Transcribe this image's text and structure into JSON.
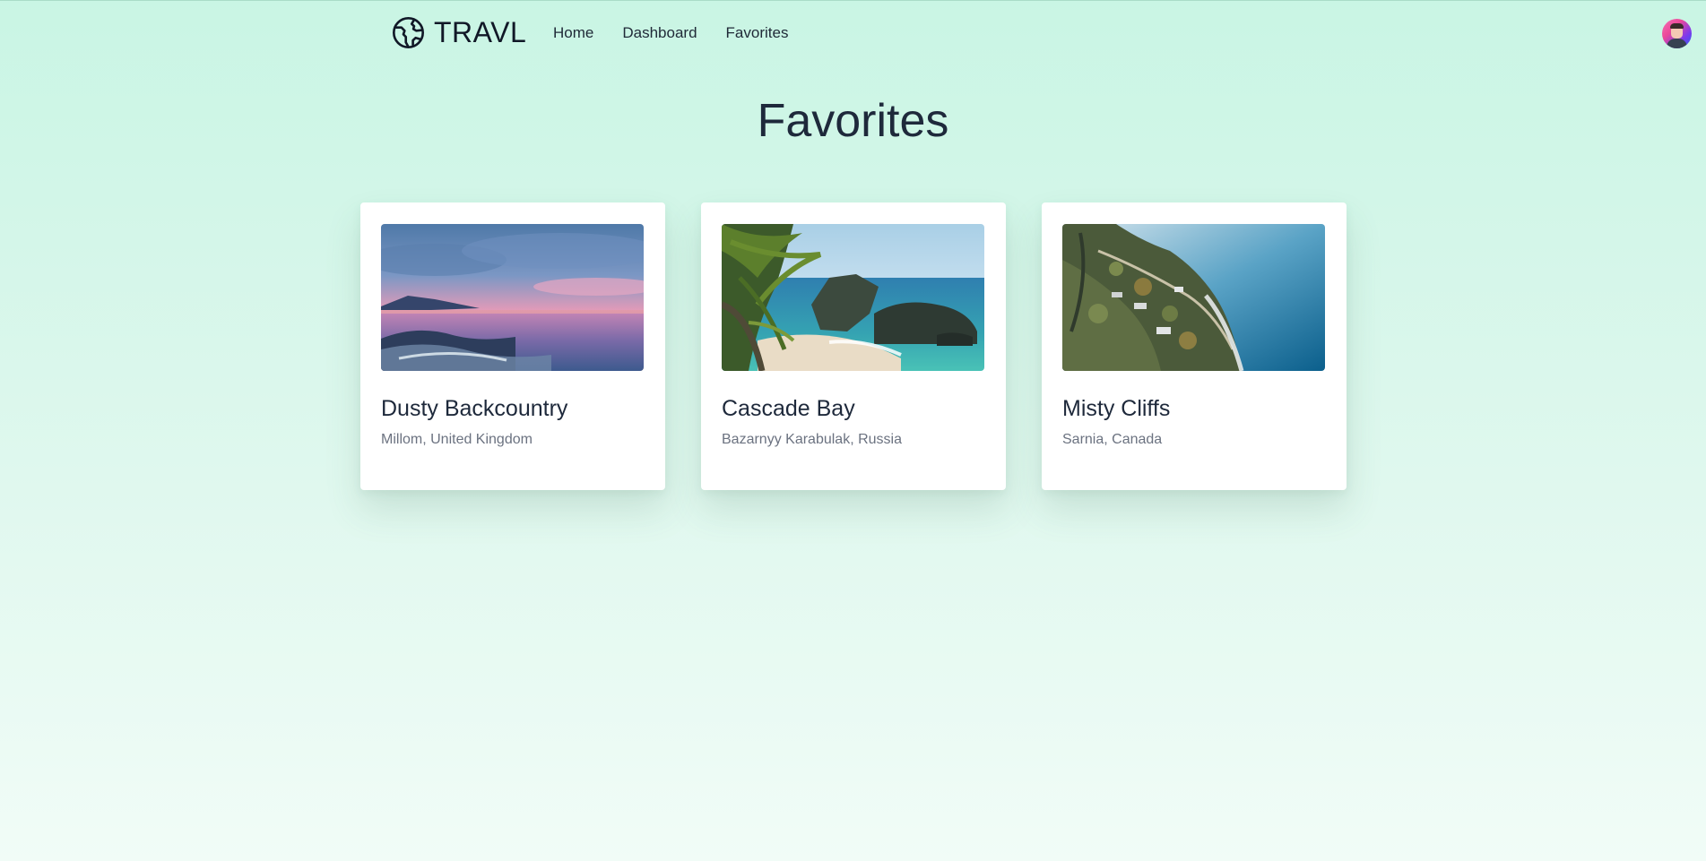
{
  "app": {
    "brand": "TRAVL",
    "brand_icon": "globe-icon"
  },
  "nav": {
    "links": [
      {
        "label": "Home"
      },
      {
        "label": "Dashboard"
      },
      {
        "label": "Favorites"
      }
    ],
    "avatar_icon": "user-avatar"
  },
  "page": {
    "title": "Favorites"
  },
  "favorites": [
    {
      "name": "Dusty Backcountry",
      "location": "Millom, United Kingdom",
      "image": "sunset-beach-photo"
    },
    {
      "name": "Cascade Bay",
      "location": "Bazarnyy Karabulak, Russia",
      "image": "palm-cove-photo"
    },
    {
      "name": "Misty Cliffs",
      "location": "Sarnia, Canada",
      "image": "aerial-coast-photo"
    }
  ],
  "colors": {
    "background_top": "#c9f5e4",
    "background_bottom": "#f1fcf7",
    "heading": "#1e293b",
    "muted_text": "#6b7280",
    "card": "#ffffff"
  }
}
